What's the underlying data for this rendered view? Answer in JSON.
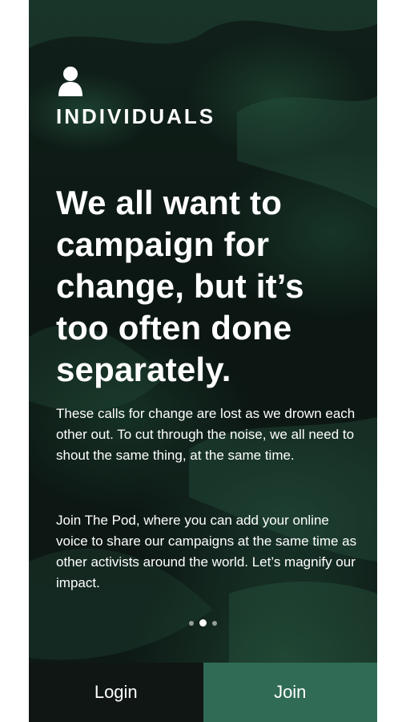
{
  "brand": {
    "icon": "person-icon",
    "name": "INDIVIDUALS"
  },
  "headline": "We all want to campaign for change, but it’s too often done separately.",
  "paragraphs": [
    "These calls for change are lost as we drown each other out. To cut through the noise, we all need to shout the same thing, at the same time.",
    "Join The Pod, where you can add your online voice to share our campaigns at the same time as other activists around the world. Let’s magnify our impact."
  ],
  "carousel": {
    "pages": 3,
    "active_index": 1
  },
  "buttons": {
    "login": "Login",
    "join": "Join"
  },
  "colors": {
    "background": "#0f1a16",
    "login_bg": "#0f1614",
    "join_bg": "#2f6b55",
    "text": "#ffffff"
  }
}
